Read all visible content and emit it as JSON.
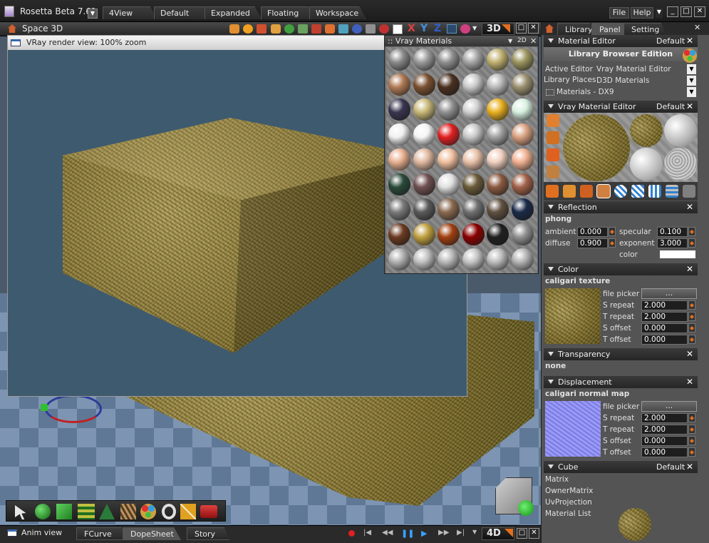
{
  "app": {
    "title": "Rosetta Beta 7.61",
    "menu_file": "File",
    "menu_help": "Help"
  },
  "top_tabs": [
    "4View",
    "Default",
    "Expanded",
    "Floating",
    "Workspace"
  ],
  "viewport": {
    "title": "Space 3D",
    "mode_label": "3D"
  },
  "render": {
    "title": "VRay render view: 100% zoom"
  },
  "vray": {
    "title": ":: Vray Materials",
    "mode": "2D",
    "balls": [
      [
        "#8a8a8a",
        "#9a9a9a",
        "#909090",
        "#a5a5a5",
        "#c0b070",
        "#9b9560"
      ],
      [
        "#b07a55",
        "#7a5030",
        "#4a3020",
        "#c8c8c8",
        "#b8b8b8",
        "#9a9070"
      ],
      [
        "#3a3550",
        "#c8b878",
        "#909090",
        "#d0d0d0",
        "#e8b020",
        "#d8f0e0"
      ],
      [
        "#f0f0f0",
        "#f4f4f4",
        "#e02020",
        "#c8c8c8",
        "#a0a0a0",
        "#d8a080"
      ],
      [
        "#e8b090",
        "#e0b8a0",
        "#f0c0a0",
        "#e8c0a8",
        "#f0d0c0",
        "#f0b090"
      ],
      [
        "#2a4a3a",
        "#705050",
        "#e0e0e0",
        "#6a5a38",
        "#8a5a40",
        "#a06048"
      ],
      [
        "#7a7a7a",
        "#5a5a5a",
        "#8a6a50",
        "#707070",
        "#605040",
        "#1a2a48"
      ],
      [
        "#6a3a20",
        "#c0a040",
        "#a04010",
        "#8a0000",
        "#202020",
        "#909090"
      ],
      [
        "#b0b0b0",
        "#c0c0c0",
        "#b8b8b8",
        "#c4c4c4",
        "#bcbcbc",
        "#b4b4b4"
      ]
    ]
  },
  "panel": {
    "tabs": [
      "Library",
      "Panel",
      "Setting"
    ],
    "material_editor": {
      "title": "Material Editor",
      "preset": "Default",
      "heading": "Library Browser Edition",
      "active_editor_label": "Active Editor",
      "active_editor_value": "Vray Material Editor",
      "library_places_label": "Library Places",
      "library_places_value": "D3D Materials",
      "materials_value": "Materials - DX9"
    },
    "vray_editor": {
      "title": "Vray Material Editor",
      "preset": "Default"
    },
    "reflection": {
      "title": "Reflection",
      "type": "phong",
      "ambient_label": "ambient",
      "ambient": "0.000",
      "specular_label": "specular",
      "specular": "0.100",
      "diffuse_label": "diffuse",
      "diffuse": "0.900",
      "exponent_label": "exponent",
      "exponent": "3.000",
      "color_label": "color"
    },
    "color": {
      "title": "Color",
      "type": "caligari texture",
      "file_picker": "file picker",
      "picker_btn": "...",
      "s_repeat_label": "S repeat",
      "s_repeat": "2.000",
      "t_repeat_label": "T repeat",
      "t_repeat": "2.000",
      "s_offset_label": "S offset",
      "s_offset": "0.000",
      "t_offset_label": "T offset",
      "t_offset": "0.000"
    },
    "transparency": {
      "title": "Transparency",
      "type": "none"
    },
    "displacement": {
      "title": "Displacement",
      "type": "caligari normal map",
      "file_picker": "file picker",
      "picker_btn": "...",
      "s_repeat_label": "S repeat",
      "s_repeat": "2.000",
      "t_repeat_label": "T repeat",
      "t_repeat": "2.000",
      "s_offset_label": "S offset",
      "s_offset": "0.000",
      "t_offset_label": "T offset",
      "t_offset": "0.000"
    },
    "cube": {
      "title": "Cube",
      "preset": "Default",
      "items": [
        "Matrix",
        "OwnerMatrix",
        "UvProjection",
        "Material List"
      ]
    }
  },
  "bottom": {
    "title": "Anim view",
    "tabs": [
      "FCurve",
      "DopeSheet",
      "Story"
    ],
    "mode_label": "4D"
  }
}
